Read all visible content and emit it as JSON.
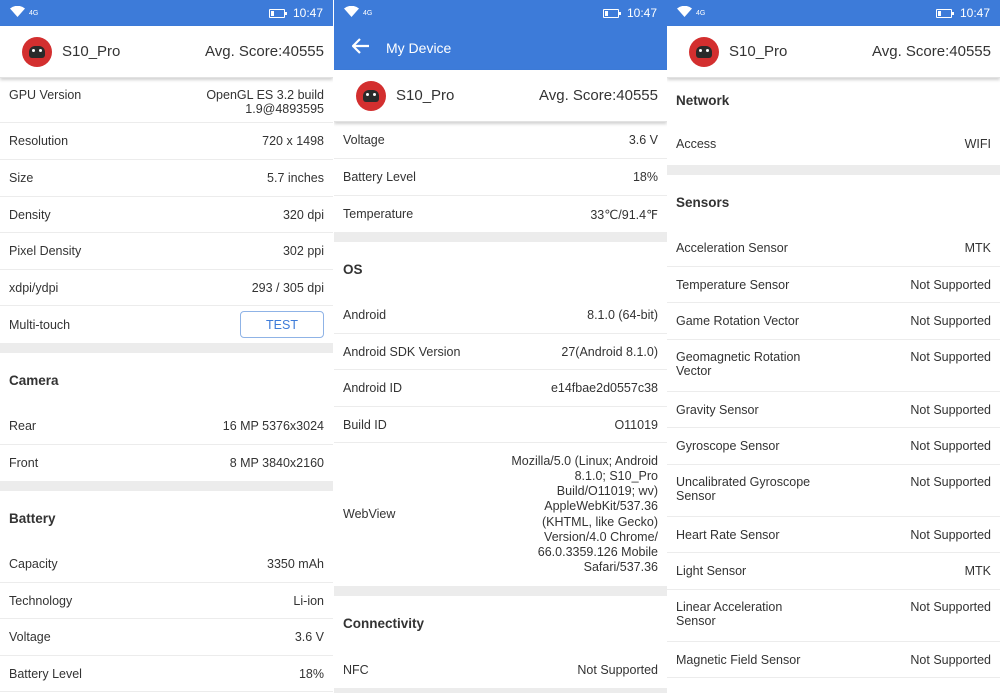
{
  "status_bar": {
    "time": "10:47",
    "network": "4G"
  },
  "header": {
    "model": "S10_Pro",
    "score": "Avg. Score:40555"
  },
  "my_device": {
    "title": "My Device"
  },
  "panel1": {
    "gpu_version": {
      "label": "GPU Version",
      "value": "OpenGL ES 3.2 build 1.9@4893595"
    },
    "display_rows": [
      {
        "label": "Resolution",
        "value": "720 x 1498"
      },
      {
        "label": "Size",
        "value": "5.7 inches"
      },
      {
        "label": "Density",
        "value": "320 dpi"
      },
      {
        "label": "Pixel Density",
        "value": "302 ppi"
      },
      {
        "label": "xdpi/ydpi",
        "value": "293 / 305 dpi"
      }
    ],
    "multitouch": {
      "label": "Multi-touch",
      "button": "TEST"
    },
    "camera": {
      "title": "Camera",
      "rows": [
        {
          "label": "Rear",
          "value": "16 MP 5376x3024"
        },
        {
          "label": "Front",
          "value": "8 MP 3840x2160"
        }
      ]
    },
    "battery": {
      "title": "Battery",
      "rows": [
        {
          "label": "Capacity",
          "value": "3350 mAh"
        },
        {
          "label": "Technology",
          "value": "Li-ion"
        },
        {
          "label": "Voltage",
          "value": "3.6 V"
        },
        {
          "label": "Battery Level",
          "value": "18%"
        }
      ]
    }
  },
  "panel2": {
    "battery_rows": [
      {
        "label": "Voltage",
        "value": "3.6 V"
      },
      {
        "label": "Battery Level",
        "value": "18%"
      },
      {
        "label": "Temperature",
        "value": "33℃/91.4℉"
      }
    ],
    "os": {
      "title": "OS",
      "rows": [
        {
          "label": "Android",
          "value": "8.1.0 (64-bit)"
        },
        {
          "label": "Android SDK Version",
          "value": "27(Android 8.1.0)"
        },
        {
          "label": "Android ID",
          "value": "e14fbae2d0557c38"
        },
        {
          "label": "Build ID",
          "value": "O11019"
        }
      ],
      "webview": {
        "label": "WebView",
        "value": "Mozilla/5.0 (Linux; Android 8.1.0; S10_Pro Build/O11019; wv) AppleWebKit/537.36 (KHTML, like Gecko) Version/4.0 Chrome/ 66.0.3359.126 Mobile Safari/537.36"
      }
    },
    "connectivity": {
      "title": "Connectivity",
      "rows": [
        {
          "label": "NFC",
          "value": "Not Supported"
        }
      ]
    }
  },
  "panel3": {
    "network": {
      "title": "Network",
      "rows": [
        {
          "label": "Access",
          "value": "WIFI"
        }
      ]
    },
    "sensors": {
      "title": "Sensors",
      "rows": [
        {
          "label": "Acceleration Sensor",
          "value": "MTK"
        },
        {
          "label": "Temperature Sensor",
          "value": "Not Supported"
        },
        {
          "label": "Game Rotation Vector",
          "value": "Not Supported"
        },
        {
          "label": "Geomagnetic Rotation Vector",
          "value": "Not Supported"
        },
        {
          "label": "Gravity Sensor",
          "value": "Not Supported"
        },
        {
          "label": "Gyroscope Sensor",
          "value": "Not Supported"
        },
        {
          "label": "Uncalibrated Gyroscope Sensor",
          "value": "Not Supported"
        },
        {
          "label": "Heart Rate Sensor",
          "value": "Not Supported"
        },
        {
          "label": "Light Sensor",
          "value": "MTK"
        },
        {
          "label": "Linear Acceleration Sensor",
          "value": "Not Supported"
        },
        {
          "label": "Magnetic Field Sensor",
          "value": "Not Supported"
        }
      ]
    }
  },
  "colors": {
    "accent": "#3d7bd9",
    "section_gap": "#ececec",
    "logo_red": "#d32f2f"
  },
  "icons": {
    "wifi": "wifi-icon",
    "back": "arrow-left-icon",
    "battery": "battery-icon",
    "logo": "antutu-logo-icon"
  }
}
